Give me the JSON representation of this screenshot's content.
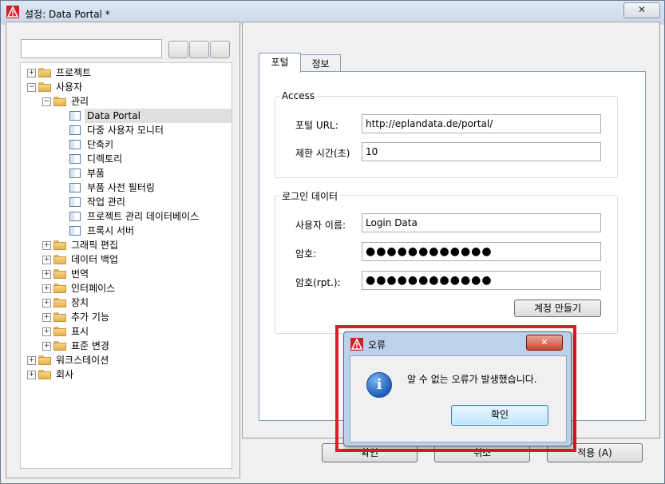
{
  "window": {
    "title": "설정: Data Portal *",
    "close_label": "✕"
  },
  "left": {
    "search_placeholder": "",
    "tree": [
      {
        "label": "프로젝트",
        "type": "folder",
        "exp": "+"
      },
      {
        "label": "사용자",
        "type": "folder",
        "exp": "−"
      },
      {
        "label": "관리",
        "type": "folder",
        "exp": "−"
      },
      {
        "label": "Data Portal",
        "type": "page"
      },
      {
        "label": "다중 사용자 모니터",
        "type": "page"
      },
      {
        "label": "단축키",
        "type": "page"
      },
      {
        "label": "디렉토리",
        "type": "page"
      },
      {
        "label": "부품",
        "type": "page"
      },
      {
        "label": "부품 사전 필터링",
        "type": "page"
      },
      {
        "label": "작업 관리",
        "type": "page"
      },
      {
        "label": "프로젝트 관리 데이터베이스",
        "type": "page"
      },
      {
        "label": "프록시 서버",
        "type": "page"
      },
      {
        "label": "그래픽 편집",
        "type": "folder",
        "exp": "+"
      },
      {
        "label": "데이터 백업",
        "type": "folder",
        "exp": "+"
      },
      {
        "label": "번역",
        "type": "folder",
        "exp": "+"
      },
      {
        "label": "인터페이스",
        "type": "folder",
        "exp": "+"
      },
      {
        "label": "장치",
        "type": "folder",
        "exp": "+"
      },
      {
        "label": "추가 기능",
        "type": "folder",
        "exp": "+"
      },
      {
        "label": "표시",
        "type": "folder",
        "exp": "+"
      },
      {
        "label": "표준 변경",
        "type": "folder",
        "exp": "+"
      },
      {
        "label": "워크스테이션",
        "type": "folder",
        "exp": "+"
      },
      {
        "label": "회사",
        "type": "folder",
        "exp": "+"
      }
    ]
  },
  "tabs": [
    {
      "label": "포털"
    },
    {
      "label": "정보"
    }
  ],
  "access": {
    "title": "Access",
    "url_label": "포털 URL:",
    "url_value": "http://eplandata.de/portal/",
    "timeout_label": "제한 시간(초)",
    "timeout_value": "10"
  },
  "login": {
    "title": "로그인 데이터",
    "user_label": "사용자 이름:",
    "user_value": "Login Data",
    "pw_label": "암호:",
    "pw_value": "●●●●●●●●●●●●",
    "pw2_label": "암호(rpt.):",
    "pw2_value": "●●●●●●●●●●●●",
    "create_btn": "계정 만들기"
  },
  "footer": {
    "ok": "확인",
    "cancel": "취소",
    "apply": "적용 (A)"
  },
  "dialog": {
    "title": "오류",
    "message": "알 수 없는 오류가 발생했습니다.",
    "ok": "확인",
    "close": "✕",
    "info_glyph": "i"
  }
}
